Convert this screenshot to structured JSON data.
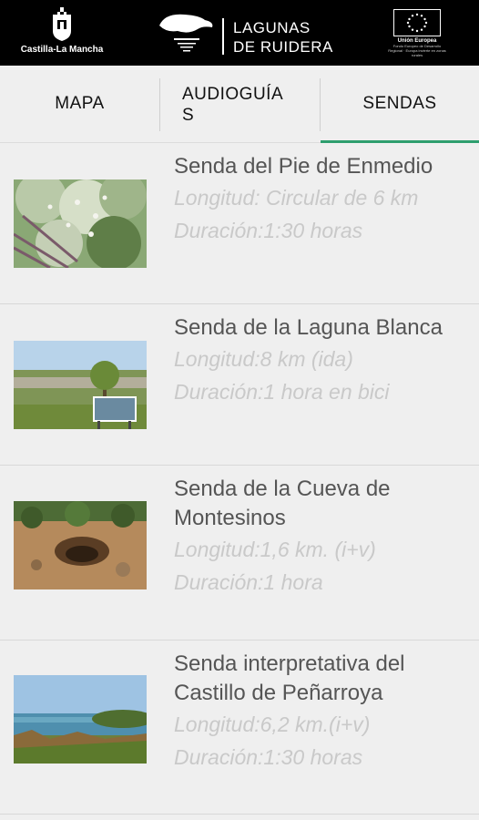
{
  "header": {
    "left_logo_text": "Castilla-La Mancha",
    "title_line1": "LAGUNAS",
    "title_line2": "DE RUIDERA",
    "eu_text": "Unión Europea",
    "eu_sub": "Fondo Europeo de Desarrollo Regional · Europa invierte en zonas rurales"
  },
  "tabs": [
    {
      "label": "MAPA",
      "selected": false
    },
    {
      "label": "AUDIOGUÍAS",
      "selected": false
    },
    {
      "label": "SENDAS",
      "selected": true
    }
  ],
  "accent_color": "#2e9e6e",
  "items": [
    {
      "title": "Senda del Pie de Enmedio",
      "length": "Longitud: Circular de 6 km",
      "duration": "Duración:1:30 horas",
      "image": "flowering-shrub-photo"
    },
    {
      "title": "Senda de la Laguna Blanca",
      "length": "Longitud:8 km (ida)",
      "duration": "Duración:1 hora en bici",
      "image": "field-with-tree-and-sign-photo"
    },
    {
      "title": "Senda de la Cueva de Montesinos",
      "length": "Longitud:1,6 km. (i+v)",
      "duration": "Duración:1 hora",
      "image": "cave-entrance-photo"
    },
    {
      "title": "Senda interpretativa del Castillo de Peñarroya",
      "length": "Longitud:6,2 km.(i+v)",
      "duration": "Duración:1:30 horas",
      "image": "lake-with-vegetation-photo"
    }
  ]
}
